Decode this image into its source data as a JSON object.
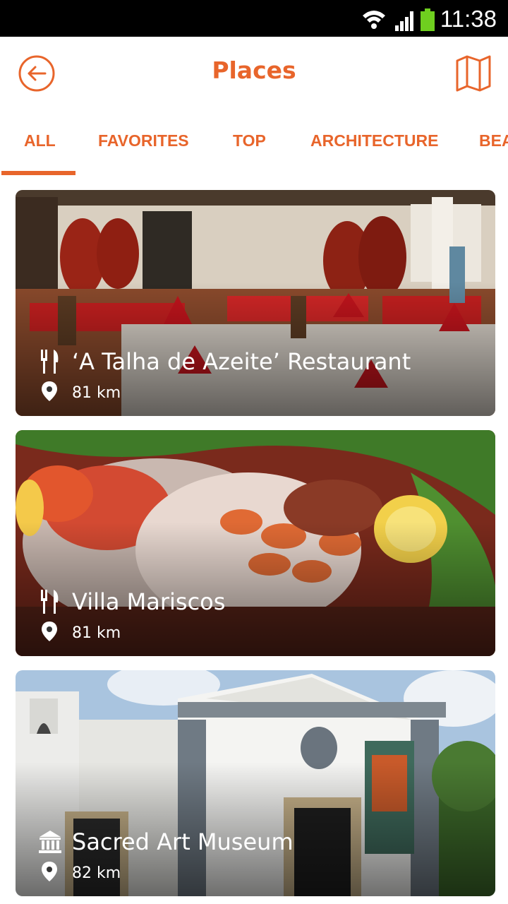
{
  "status_bar": {
    "time": "11:38"
  },
  "header": {
    "title": "Places"
  },
  "tabs": [
    "ALL",
    "FAVORITES",
    "TOP",
    "ARCHITECTURE",
    "BEA"
  ],
  "places": [
    {
      "name": "‘A Talha de Azeite’ Restaurant",
      "distance": "81 km",
      "category_icon": "fork-knife-icon"
    },
    {
      "name": "Villa Mariscos",
      "distance": "81 km",
      "category_icon": "fork-knife-icon"
    },
    {
      "name": "Sacred Art Museum",
      "distance": "82 km",
      "category_icon": "museum-icon"
    }
  ],
  "colors": {
    "accent": "#e8652b",
    "status_bar": "#000000",
    "background": "#ffffff"
  }
}
